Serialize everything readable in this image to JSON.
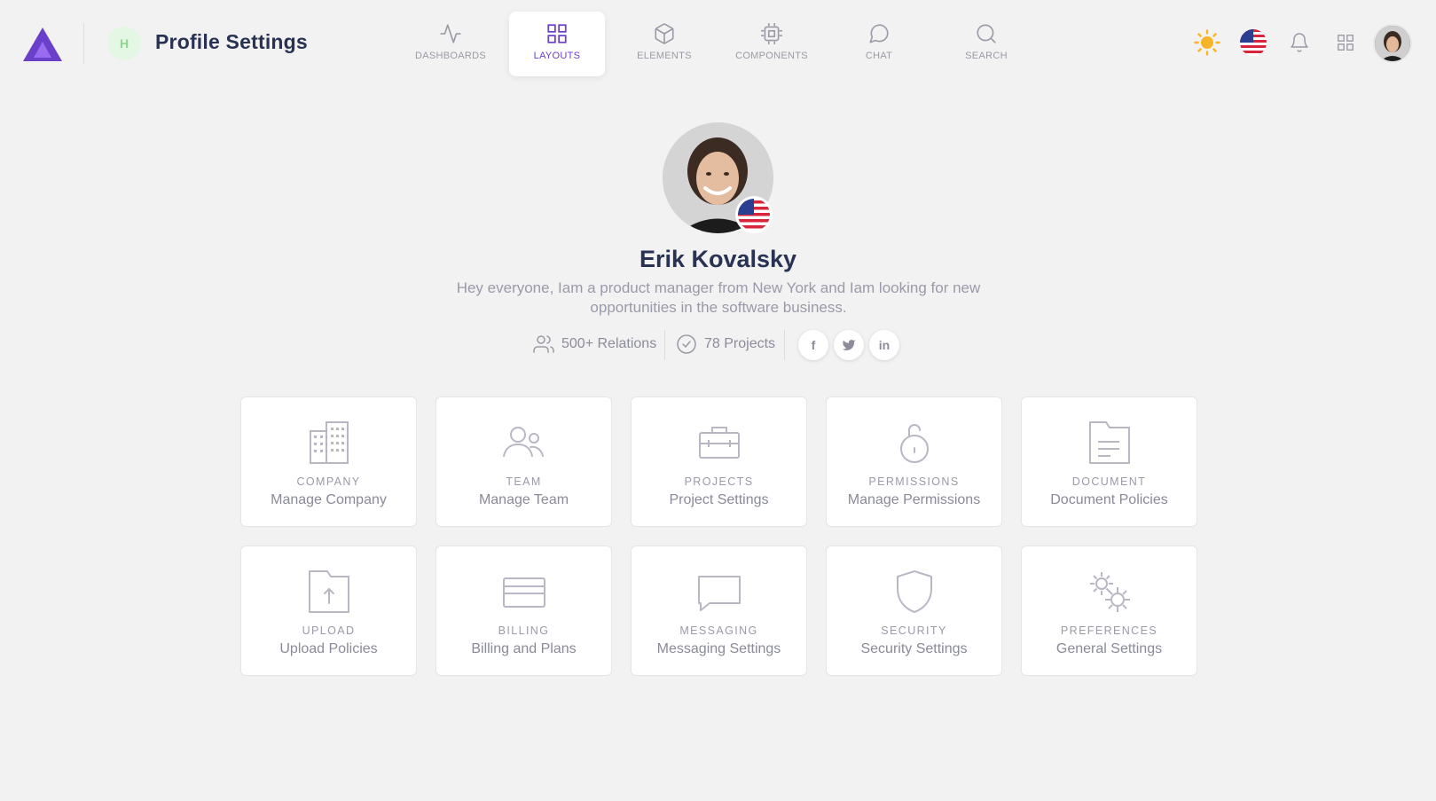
{
  "header": {
    "badge": "H",
    "title": "Profile Settings"
  },
  "nav": [
    {
      "label": "DASHBOARDS",
      "icon": "activity-icon"
    },
    {
      "label": "LAYOUTS",
      "icon": "grid-icon",
      "active": true
    },
    {
      "label": "ELEMENTS",
      "icon": "box-icon"
    },
    {
      "label": "COMPONENTS",
      "icon": "cpu-icon"
    },
    {
      "label": "CHAT",
      "icon": "chat-bubble-icon"
    },
    {
      "label": "SEARCH",
      "icon": "search-icon"
    }
  ],
  "profile": {
    "name": "Erik Kovalsky",
    "bio": "Hey everyone, Iam a product manager from New York and Iam looking for new opportunities in the software business.",
    "relations": "500+ Relations",
    "projects": "78 Projects",
    "social": [
      "f",
      "t",
      "in"
    ]
  },
  "cards": [
    {
      "category": "COMPANY",
      "label": "Manage Company",
      "icon": "building-icon"
    },
    {
      "category": "TEAM",
      "label": "Manage Team",
      "icon": "users-icon"
    },
    {
      "category": "PROJECTS",
      "label": "Project Settings",
      "icon": "briefcase-icon"
    },
    {
      "category": "PERMISSIONS",
      "label": "Manage Permissions",
      "icon": "unlock-icon"
    },
    {
      "category": "DOCUMENT",
      "label": "Document Policies",
      "icon": "document-icon"
    },
    {
      "category": "UPLOAD",
      "label": "Upload Policies",
      "icon": "folder-upload-icon"
    },
    {
      "category": "BILLING",
      "label": "Billing and Plans",
      "icon": "credit-card-icon"
    },
    {
      "category": "MESSAGING",
      "label": "Messaging Settings",
      "icon": "message-square-icon"
    },
    {
      "category": "SECURITY",
      "label": "Security Settings",
      "icon": "shield-icon"
    },
    {
      "category": "PREFERENCES",
      "label": "General Settings",
      "icon": "gears-icon"
    }
  ],
  "colors": {
    "accent": "#6a3fc9",
    "background": "#f2f2f2",
    "sun": "#f8b427",
    "text": "#283252"
  }
}
